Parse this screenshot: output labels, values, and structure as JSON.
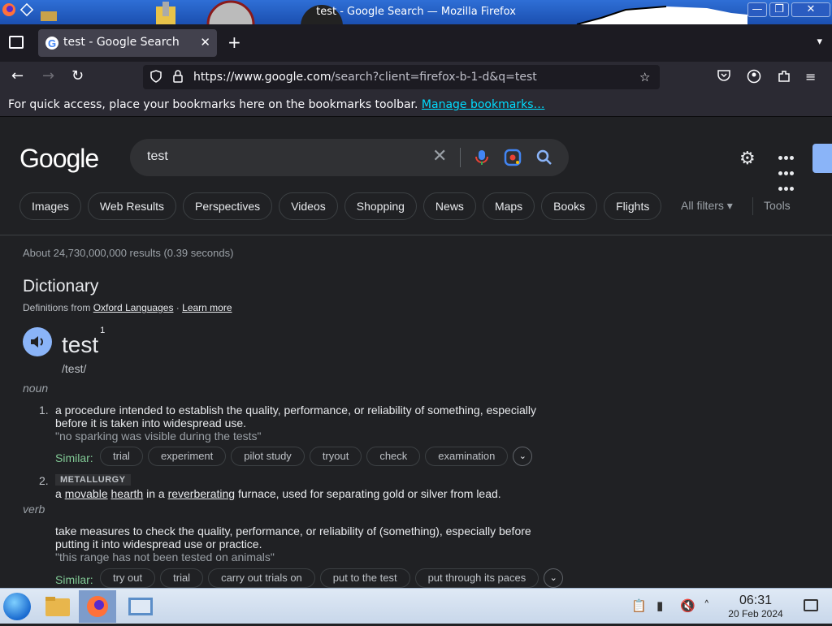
{
  "window": {
    "title": "test - Google Search — Mozilla Firefox",
    "minimize": "—",
    "maximize": "❐",
    "close": "✕"
  },
  "tabs": [
    {
      "label": "test - Google Search",
      "close": "✕"
    }
  ],
  "new_tab": "+",
  "nav": {
    "url_domain": "https://www.google.com",
    "url_path": "/search?client=firefox-b-1-d&q=test"
  },
  "bookmarks_bar": {
    "message": "For quick access, place your bookmarks here on the bookmarks toolbar.",
    "manage_link": "Manage bookmarks…"
  },
  "google": {
    "logo": "Google",
    "query": "test",
    "clear": "✕",
    "chips": [
      "Images",
      "Web Results",
      "Perspectives",
      "Videos",
      "Shopping",
      "News",
      "Maps",
      "Books",
      "Flights"
    ],
    "all_filters": "All filters ▾",
    "tools": "Tools",
    "stats": "About 24,730,000,000 results (0.39 seconds)"
  },
  "dictionary": {
    "title": "Dictionary",
    "source_prefix": "Definitions from",
    "source_link": "Oxford Languages",
    "separator": " · ",
    "learn_more": "Learn more",
    "word": "test",
    "superscript": "1",
    "phonetic": "/test/",
    "noun_label": "noun",
    "def1_num": "1.",
    "def1": "a procedure intended to establish the quality, performance, or reliability of something, especially before it is taken into widespread use.",
    "def1_example": "\"no sparking was visible during the tests\"",
    "similar_label": "Similar:",
    "def1_similar": [
      "trial",
      "experiment",
      "pilot study",
      "tryout",
      "check",
      "examination"
    ],
    "def2_num": "2.",
    "def2_badge": "METALLURGY",
    "def2_a": "a ",
    "def2_w1": "movable",
    "def2_sp1": " ",
    "def2_w2": "hearth",
    "def2_b": " in a ",
    "def2_w3": "reverberating",
    "def2_c": " furnace, used for separating gold or silver from lead.",
    "verb_label": "verb",
    "def3": "take measures to check the quality, performance, or reliability of (something), especially before putting it into widespread use or practice.",
    "def3_example": "\"this range has not been tested on animals\"",
    "def3_similar": [
      "try out",
      "trial",
      "carry out trials on",
      "put to the test",
      "put through its paces"
    ],
    "more": "⌄"
  },
  "taskbar": {
    "time": "06:31",
    "date": "20 Feb 2024"
  },
  "colors": {
    "accent_blue": "#8ab4f8",
    "similar_green": "#81c995",
    "link_cyan": "#00ddff"
  }
}
